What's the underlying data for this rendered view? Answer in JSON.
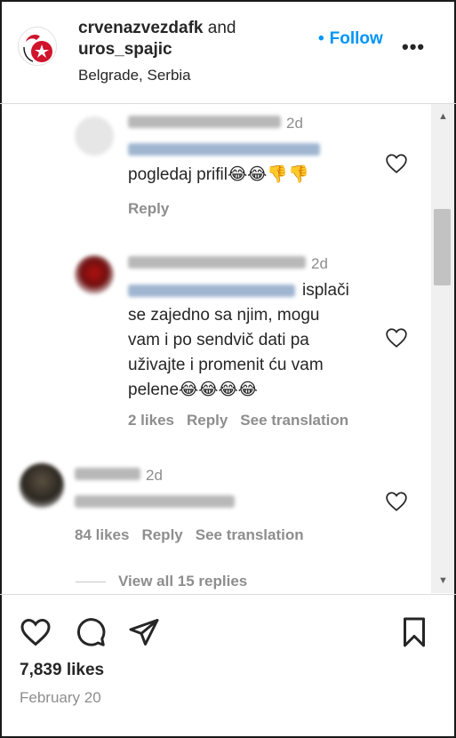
{
  "header": {
    "account": "crvenazvezdafk",
    "and_text": "and",
    "coauthor": "uros_spajic",
    "location": "Belgrade, Serbia",
    "follow_dot": "•",
    "follow_label": "Follow",
    "more_label": "•••"
  },
  "comments": [
    {
      "time": "2d",
      "text": "pogledaj prifil😂😂👎👎",
      "actions": {
        "reply": "Reply"
      }
    },
    {
      "time": "2d",
      "text_after_mention": "isplači",
      "text_lines": [
        "se zajedno sa njim, mogu",
        "vam i po sendvič dati pa",
        "uživajte i promenit ću vam",
        "pelene😂😂😂😂"
      ],
      "actions": {
        "likes": "2 likes",
        "reply": "Reply",
        "translate": "See translation"
      }
    },
    {
      "time": "2d",
      "actions": {
        "likes": "84 likes",
        "reply": "Reply",
        "translate": "See translation"
      }
    }
  ],
  "view_replies": "View all 15 replies",
  "post": {
    "likes": "7,839 likes",
    "date": "February 20"
  },
  "icons": {
    "like": "heart-icon",
    "comment": "comment-icon",
    "share": "share-icon",
    "save": "bookmark-icon",
    "more": "more-horizontal-icon"
  },
  "colors": {
    "accent": "#0095f6",
    "text": "#262626",
    "secondary": "#8e8e8e",
    "brand_red": "#d0142c"
  }
}
